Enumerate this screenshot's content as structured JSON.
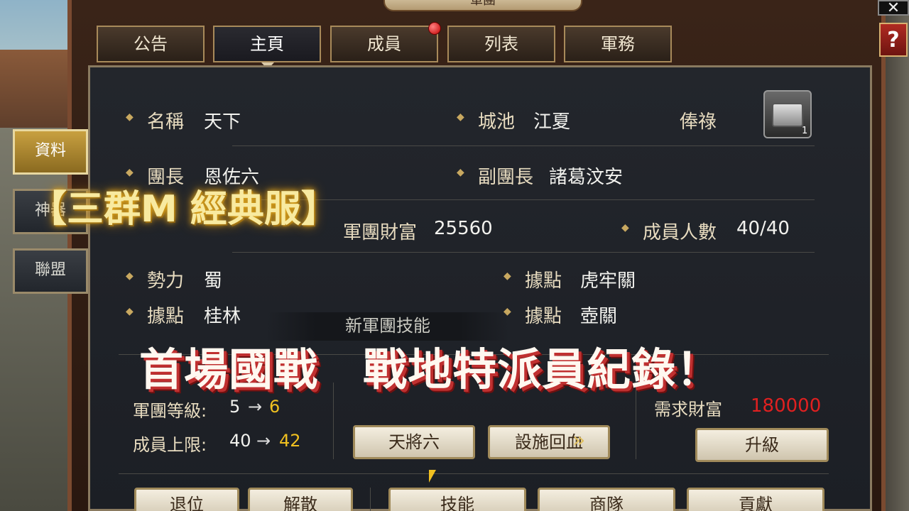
{
  "title": "軍團",
  "tabs": [
    {
      "label": "公告"
    },
    {
      "label": "主頁",
      "active": true
    },
    {
      "label": "成員",
      "badge": true
    },
    {
      "label": "列表"
    },
    {
      "label": "軍務"
    }
  ],
  "side_tabs": [
    {
      "label": "資料",
      "active": true
    },
    {
      "label": "神器"
    },
    {
      "label": "聯盟"
    }
  ],
  "info": {
    "name_label": "名稱",
    "name": "天下",
    "city_label": "城池",
    "city": "江夏",
    "salary_label": "俸祿",
    "chest_count": "1",
    "leader_label": "團長",
    "leader": "恩佐六",
    "vice_label": "副團長",
    "vice": "諸葛汶安",
    "wealth_label": "軍團財富",
    "wealth": "25560",
    "members_label": "成員人數",
    "members": "40/40",
    "faction_label": "勢力",
    "faction": "蜀",
    "base1_label": "據點",
    "base1": "虎牢關",
    "base2_label": "據點",
    "base2": "桂林",
    "base3_label": "據點",
    "base3": "壺關"
  },
  "upgrade": {
    "title": "新軍團技能",
    "level_label": "軍團等級:",
    "level_from": "5",
    "level_to": "6",
    "cap_label": "成員上限:",
    "cap_from": "40",
    "cap_to": "42",
    "arrow": "→",
    "skill1": "天將六",
    "skill2": "設施回血",
    "req_label": "需求財富",
    "req_value": "180000",
    "upgrade_btn": "升級"
  },
  "bottom_buttons": [
    "退位",
    "解散",
    "技能",
    "商隊",
    "貢獻"
  ],
  "captions": {
    "top": "【三群M 經典服】",
    "main": "首場國戰　戰地特派員紀錄！"
  },
  "colors": {
    "gold": "#f0c020",
    "red": "#e02020"
  }
}
